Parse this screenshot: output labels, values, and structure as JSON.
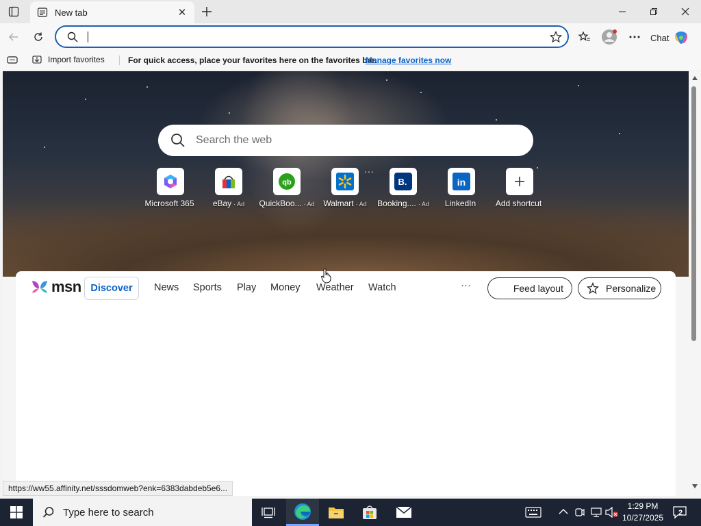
{
  "browser": {
    "tab_title": "New tab",
    "address_value": "",
    "chat_label": "Chat"
  },
  "favorites_bar": {
    "import_label": "Import favorites",
    "message": "For quick access, place your favorites here on the favorites bar.",
    "manage_link": "Manage favorites now"
  },
  "newtab": {
    "search_placeholder": "Search the web",
    "shortcuts": [
      {
        "label": "Microsoft 365",
        "ad": "",
        "icon": "microsoft-365-icon"
      },
      {
        "label": "eBay",
        "ad": "· Ad",
        "icon": "ebay-icon"
      },
      {
        "label": "QuickBoo...",
        "ad": "· Ad",
        "icon": "quickbooks-icon"
      },
      {
        "label": "Walmart",
        "ad": "· Ad",
        "icon": "walmart-icon"
      },
      {
        "label": "Booking....",
        "ad": "· Ad",
        "icon": "booking-icon"
      },
      {
        "label": "LinkedIn",
        "ad": "",
        "icon": "linkedin-icon"
      },
      {
        "label": "Add shortcut",
        "ad": "",
        "icon": "plus-icon"
      }
    ]
  },
  "feed": {
    "logo_text": "msn",
    "nav": [
      "Discover",
      "News",
      "Sports",
      "Play",
      "Money",
      "Weather",
      "Watch"
    ],
    "more": "···",
    "feed_layout_label": "Feed layout",
    "personalize_label": "Personalize"
  },
  "status_url": "https://ww55.affinity.net/sssdomweb?enk=6383dabdeb5e6...",
  "taskbar": {
    "search_placeholder": "Type here to search",
    "time": "1:29 PM",
    "date": "10/27/2025",
    "notification_count": "2"
  },
  "colors": {
    "accent": "#1a5fb4",
    "link": "#0b63c7",
    "taskbar": "#1c2433"
  }
}
